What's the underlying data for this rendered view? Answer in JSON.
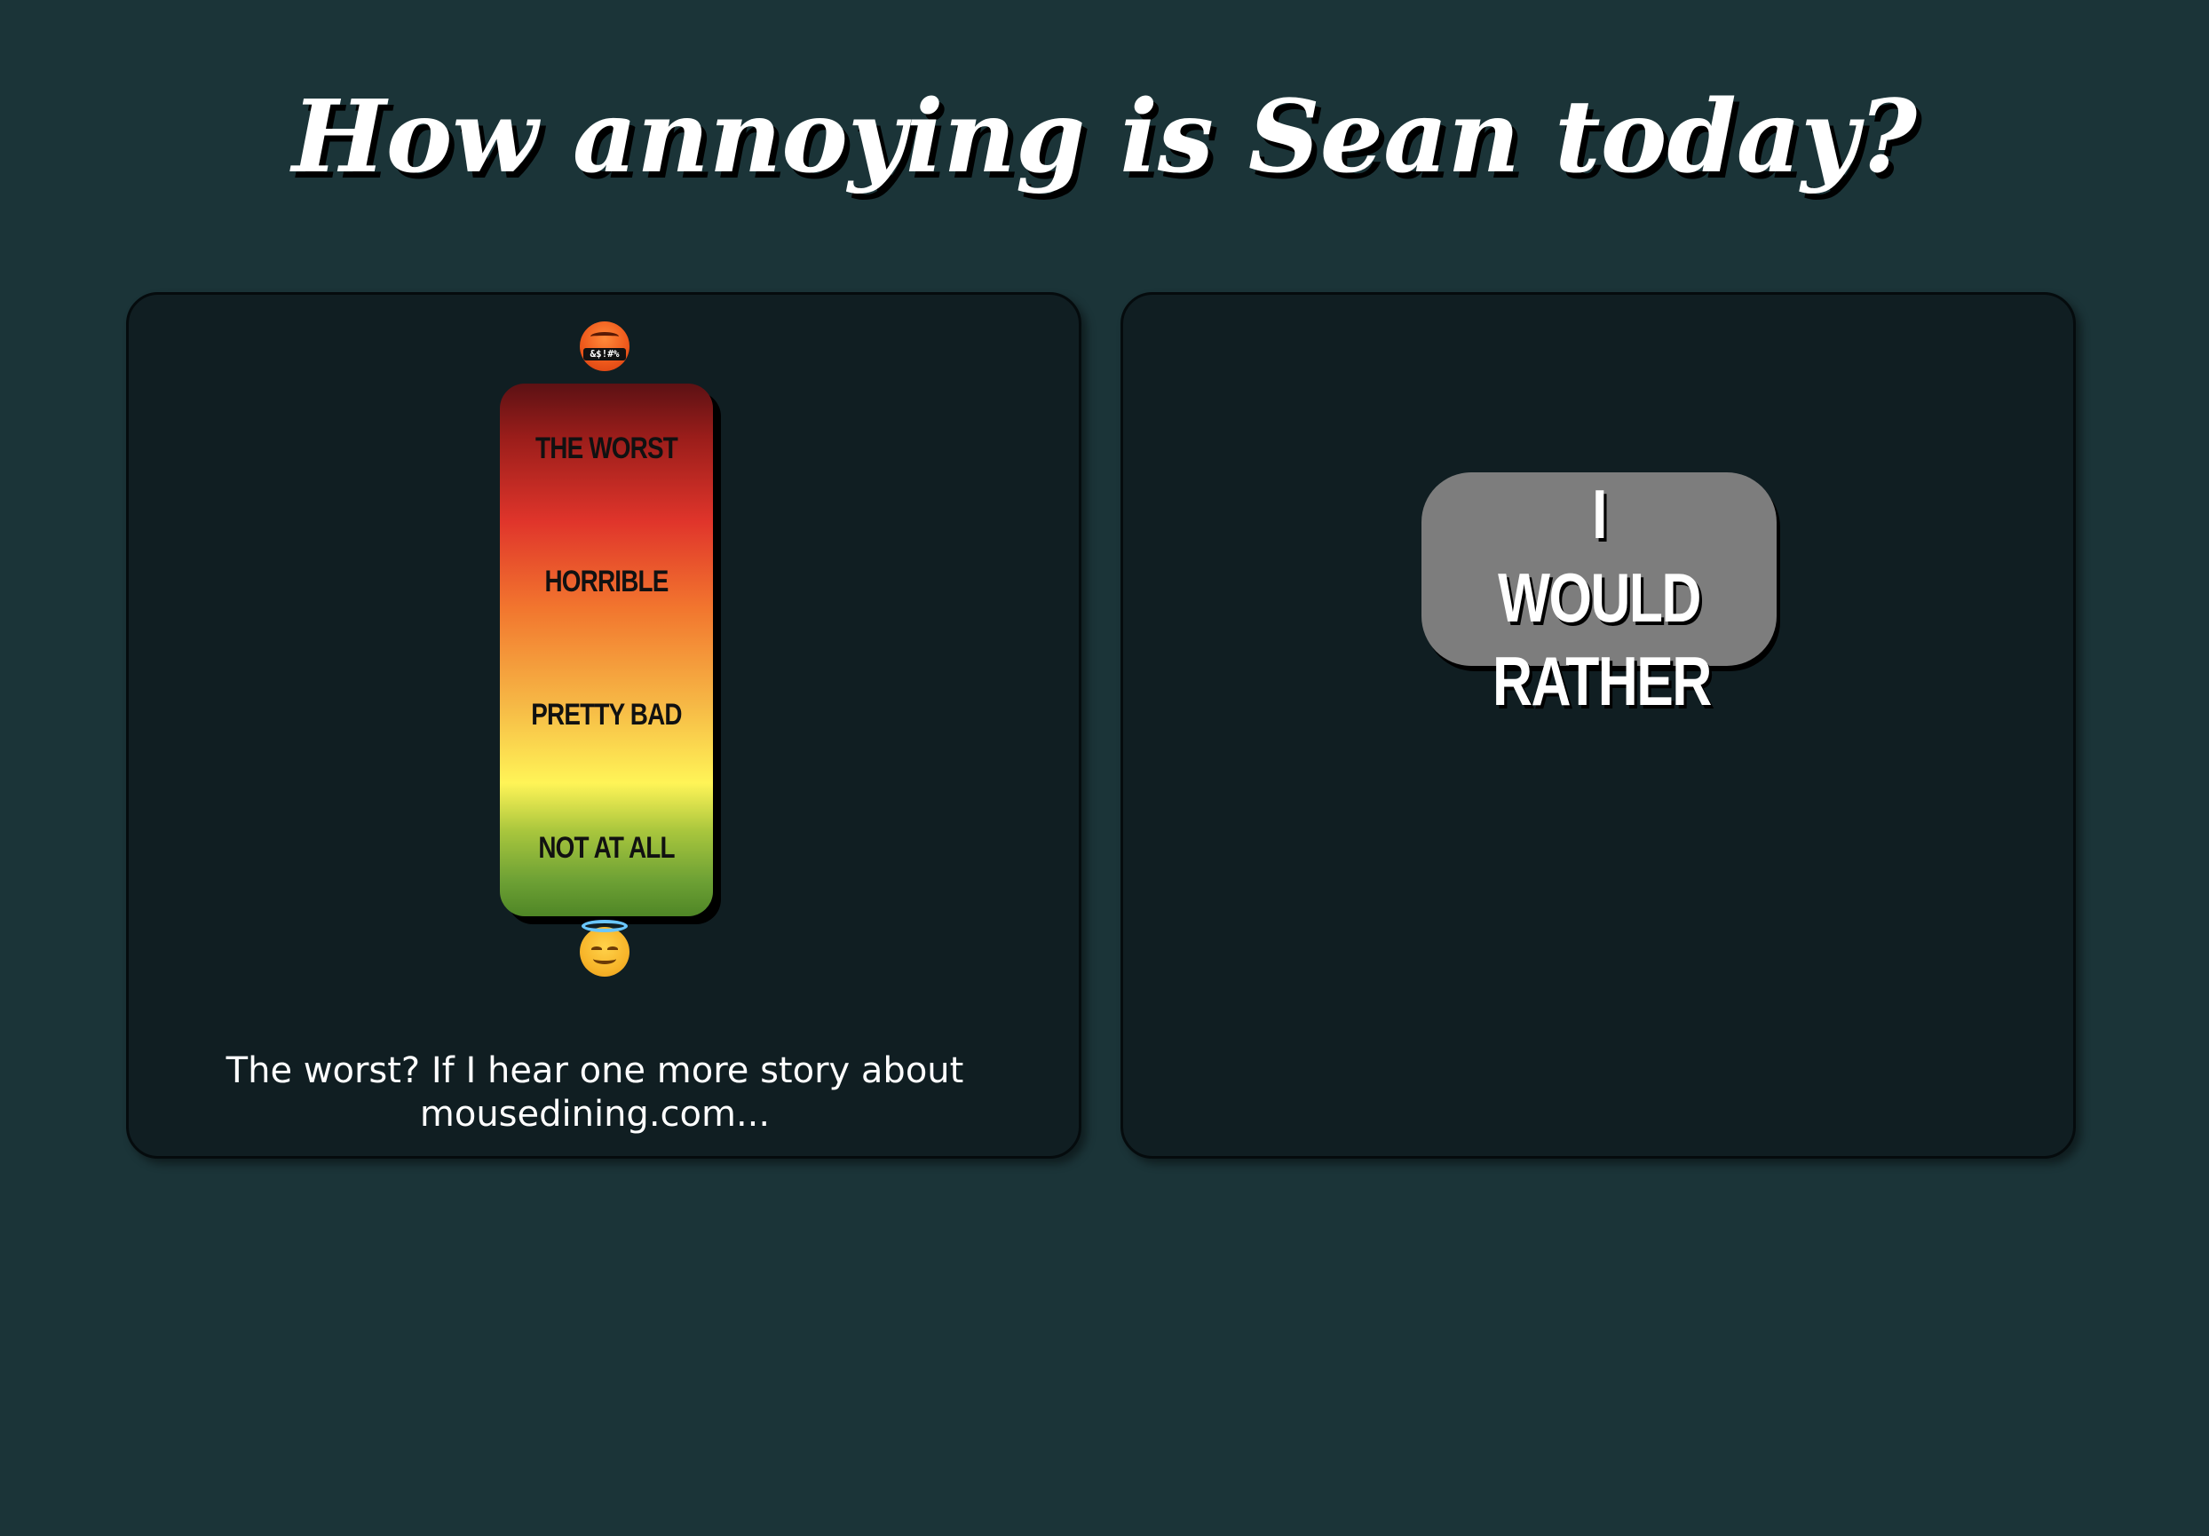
{
  "header": {
    "title": "How annoying is Sean today?"
  },
  "meter": {
    "top_icon": "face-with-symbols-on-mouth-icon",
    "top_icon_text": "&$!#%",
    "bottom_icon": "smiling-face-with-halo-icon",
    "levels": [
      {
        "label": "The worst"
      },
      {
        "label": "Horrible"
      },
      {
        "label": "Pretty bad"
      },
      {
        "label": "Not at all"
      }
    ],
    "colors": {
      "top": "#5c1114",
      "red": "#e0352b",
      "orange": "#f2752e",
      "yellow": "#fff457",
      "green": "#4f8626"
    }
  },
  "comment": {
    "text": "The worst? If I hear one more story about mousedining.com..."
  },
  "actions": {
    "rather_label": "I would rather"
  },
  "colors": {
    "background": "#1b3438",
    "panel": "#101e22",
    "button": "#7d7d7d"
  }
}
